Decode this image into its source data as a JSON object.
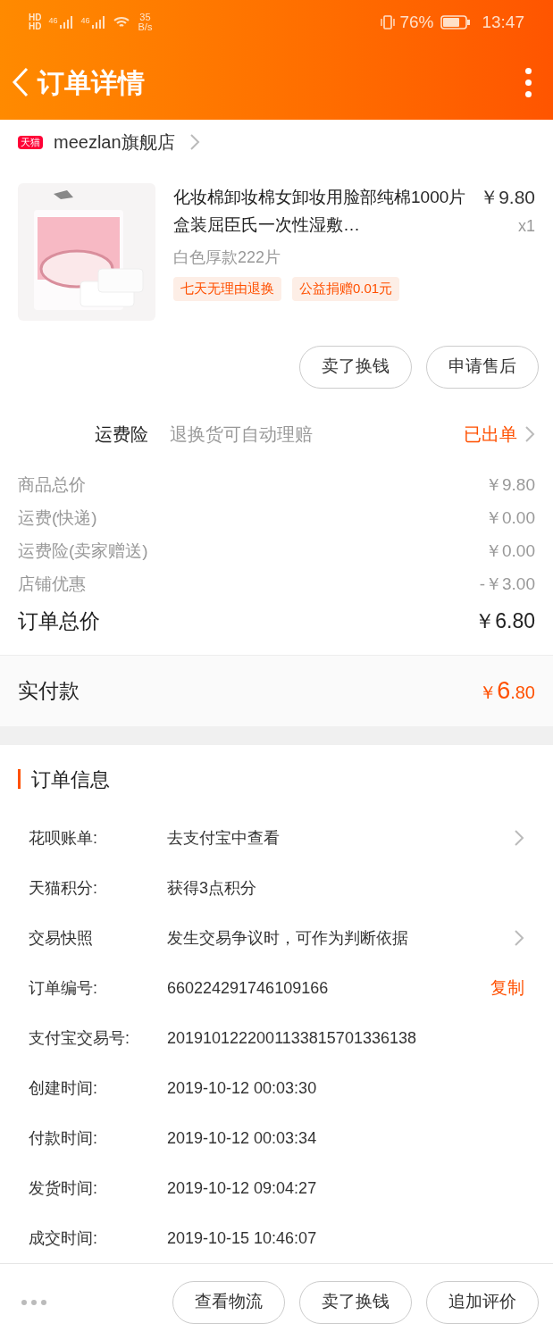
{
  "status_bar": {
    "network": [
      "HD",
      "HD"
    ],
    "signal": [
      "46",
      "46"
    ],
    "speed": "35",
    "speed_unit": "B/s",
    "battery": "76%",
    "time": "13:47"
  },
  "header": {
    "title": "订单详情"
  },
  "shop": {
    "badge": "天猫",
    "name": "meezlan旗舰店"
  },
  "product": {
    "kind": "picture",
    "title": "化妆棉卸妆棉女卸妆用脸部纯棉1000片盒装屈臣氏一次性湿敷…",
    "price": "￥9.80",
    "quantity": "x1",
    "variant": "白色厚款222片",
    "tags": [
      "七天无理由退换",
      "公益捐赠0.01元"
    ]
  },
  "item_buttons": [
    "卖了换钱",
    "申请售后"
  ],
  "insurance": {
    "label": "运费险",
    "description": "退换货可自动理赔",
    "status": "已出单"
  },
  "fees": [
    {
      "label": "商品总价",
      "value": "￥9.80"
    },
    {
      "label": "运费(快递)",
      "value": "￥0.00"
    },
    {
      "label": "运费险(卖家赠送)",
      "value": "￥0.00"
    },
    {
      "label": "店铺优惠",
      "value": "-￥3.00"
    }
  ],
  "order_total": {
    "label": "订单总价",
    "value": "￥6.80"
  },
  "paid": {
    "label": "实付款",
    "currency": "￥",
    "integer": "6",
    "decimal": ".80"
  },
  "order_info": {
    "title": "订单信息",
    "rows": [
      {
        "label": "花呗账单:",
        "value": "去支付宝中查看",
        "kind": "link"
      },
      {
        "label": "天猫积分:",
        "value": "获得3点积分",
        "kind": "plain"
      },
      {
        "label": "交易快照",
        "value": "发生交易争议时，可作为判断依据",
        "kind": "link"
      },
      {
        "label": "订单编号:",
        "value": "660224291746109166",
        "kind": "action",
        "action": "复制"
      },
      {
        "label": "支付宝交易号:",
        "value": "2019101222001133815701336138",
        "kind": "plain"
      },
      {
        "label": "创建时间:",
        "value": "2019-10-12 00:03:30",
        "kind": "plain"
      },
      {
        "label": "付款时间:",
        "value": "2019-10-12 00:03:34",
        "kind": "plain"
      },
      {
        "label": "发货时间:",
        "value": "2019-10-12 09:04:27",
        "kind": "plain"
      },
      {
        "label": "成交时间:",
        "value": "2019-10-15 10:46:07",
        "kind": "plain"
      }
    ]
  },
  "bottom_buttons": [
    "查看物流",
    "卖了换钱",
    "追加评价"
  ]
}
